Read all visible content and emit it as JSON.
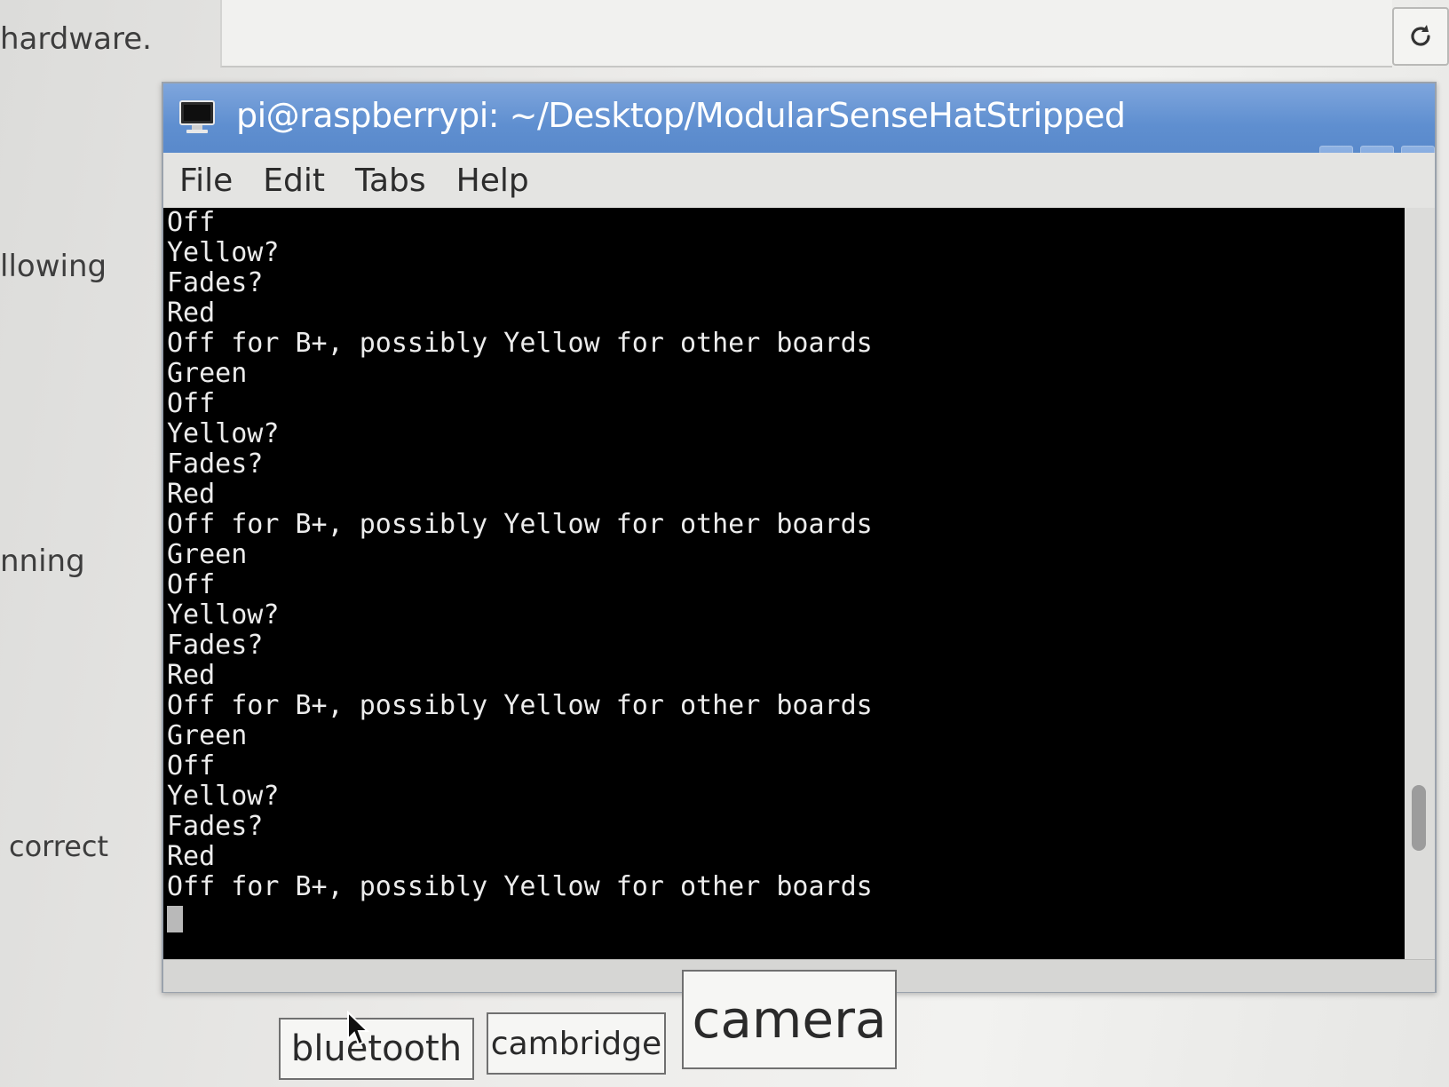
{
  "background": {
    "words": [
      "hardware.",
      "llowing",
      "nning",
      "correct"
    ],
    "reload_icon": "reload-icon"
  },
  "terminal": {
    "title": "pi@raspberrypi: ~/Desktop/ModularSenseHatStripped",
    "app_icon": "terminal-monitor-icon",
    "titlebar_color": "#5f8fd0",
    "menu": [
      "File",
      "Edit",
      "Tabs",
      "Help"
    ],
    "window_buttons": {
      "minimize": "–",
      "maximize": "▫",
      "close": "×"
    },
    "lines": [
      "Off",
      "Yellow?",
      "Fades?",
      "Red",
      "Off for B+, possibly Yellow for other boards",
      "Green",
      "Off",
      "Yellow?",
      "Fades?",
      "Red",
      "Off for B+, possibly Yellow for other boards",
      "Green",
      "Off",
      "Yellow?",
      "Fades?",
      "Red",
      "Off for B+, possibly Yellow for other boards",
      "Green",
      "Off",
      "Yellow?",
      "Fades?",
      "Red",
      "Off for B+, possibly Yellow for other boards"
    ]
  },
  "tags": [
    "bluetooth",
    "cambridge",
    "camera"
  ]
}
